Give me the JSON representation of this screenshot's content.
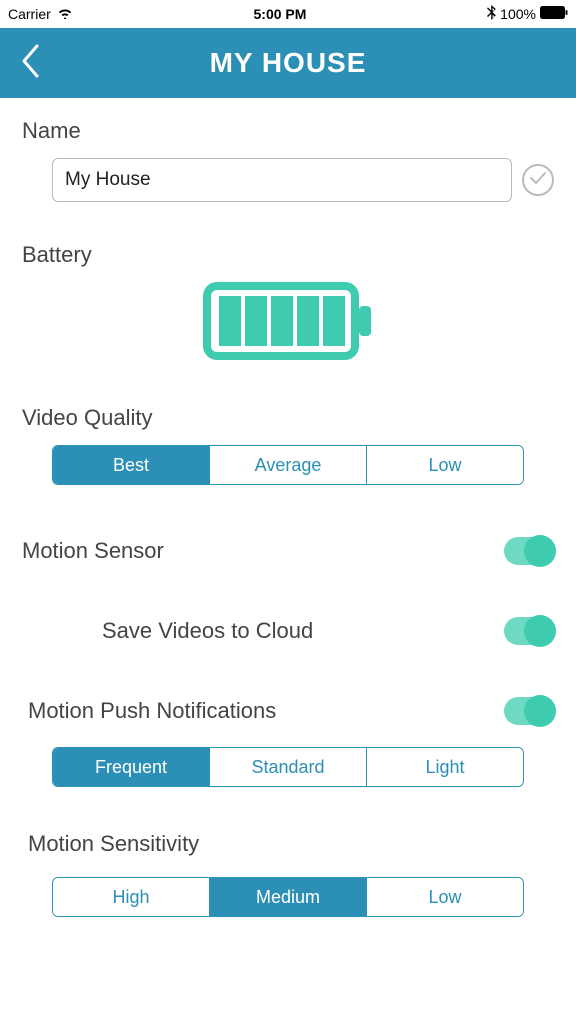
{
  "status": {
    "carrier": "Carrier",
    "time": "5:00 PM",
    "battery_pct": "100%"
  },
  "nav": {
    "title": "MY HOUSE"
  },
  "name": {
    "label": "Name",
    "value": "My House"
  },
  "battery": {
    "label": "Battery",
    "level": 5
  },
  "video_quality": {
    "label": "Video Quality",
    "options": [
      "Best",
      "Average",
      "Low"
    ],
    "selected": 0
  },
  "motion_sensor": {
    "label": "Motion Sensor",
    "on": true
  },
  "save_cloud": {
    "label": "Save Videos to Cloud",
    "on": true
  },
  "push": {
    "label": "Motion Push Notifications",
    "on": true,
    "options": [
      "Frequent",
      "Standard",
      "Light"
    ],
    "selected": 0
  },
  "sensitivity": {
    "label": "Motion Sensitivity",
    "options": [
      "High",
      "Medium",
      "Low"
    ],
    "selected": 1
  }
}
